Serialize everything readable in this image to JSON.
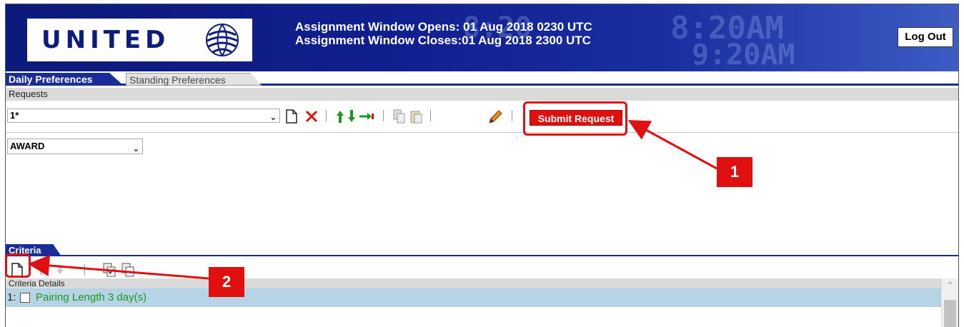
{
  "header": {
    "logo_text": "UNITED",
    "window_opens": "Assignment Window Opens: 01 Aug 2018 0230 UTC",
    "window_closes": "Assignment Window Closes:01 Aug 2018 2300 UTC",
    "logout_label": "Log Out"
  },
  "tabs": [
    {
      "label": "Daily Preferences",
      "active": true
    },
    {
      "label": "Standing Preferences",
      "active": false
    }
  ],
  "requests": {
    "section_label": "Requests",
    "selected_request": "1*",
    "toolbar_icons": [
      "new-document-icon",
      "delete-icon",
      "move-up-icon",
      "move-down-icon",
      "move-to-icon",
      "copy-icon",
      "paste-icon",
      "edit-pencil-icon"
    ],
    "submit_label": "Submit Request",
    "award_type": "AWARD"
  },
  "criteria": {
    "tab_label": "Criteria",
    "details_label": "Criteria Details",
    "toolbar_icons": [
      "new-criteria-icon",
      "move-up-icon",
      "move-down-icon",
      "copy-icon",
      "paste-icon"
    ],
    "items": [
      {
        "number": "1:",
        "checked": false,
        "label": "Pairing Length 3 day(s)"
      }
    ]
  },
  "annotations": [
    {
      "number": "1",
      "target": "submit-button"
    },
    {
      "number": "2",
      "target": "new-criteria-button"
    }
  ],
  "colors": {
    "header_blue": "#0c1a7a",
    "tab_blue": "#1a2c9a",
    "submit_red": "#e01010",
    "criteria_green": "#1a9a1a",
    "criteria_row_bg": "#b7d3e6"
  }
}
